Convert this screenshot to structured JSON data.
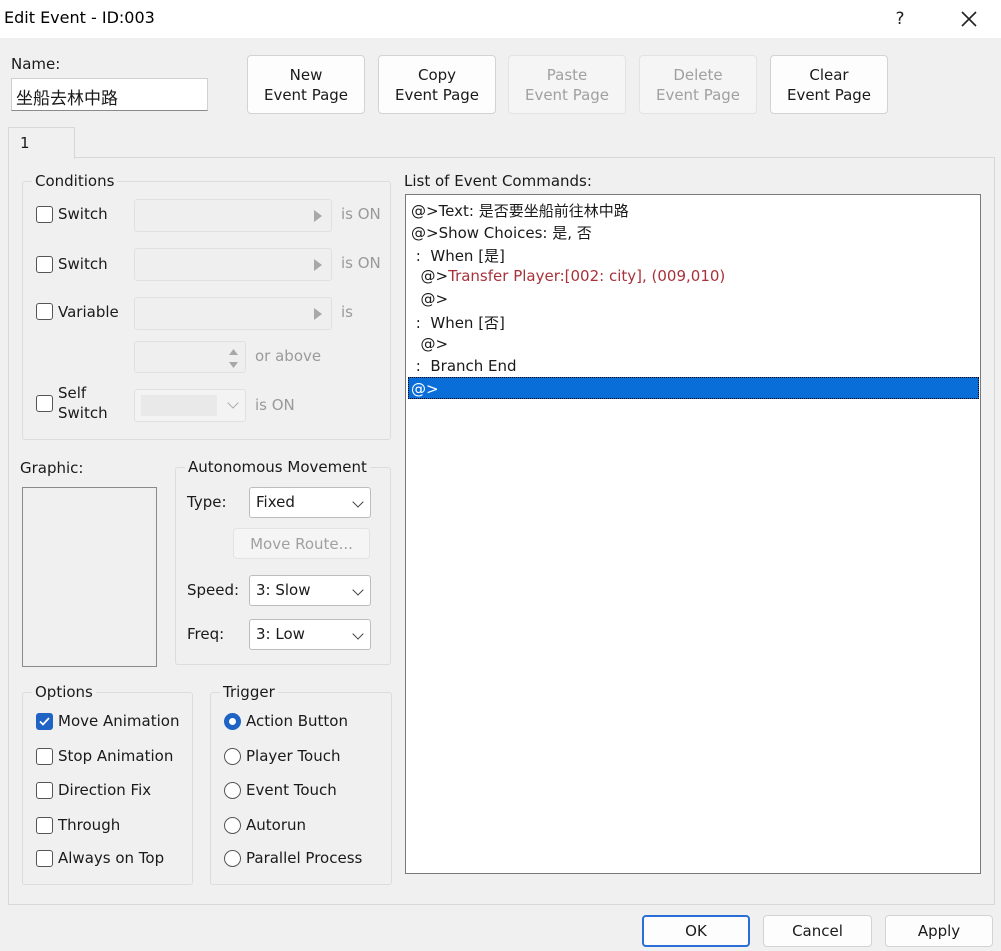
{
  "window": {
    "title": "Edit Event - ID:003",
    "help": "?"
  },
  "name_section": {
    "label": "Name:",
    "value": "坐船去林中路"
  },
  "page_buttons": {
    "new": "New\nEvent Page",
    "copy": "Copy\nEvent Page",
    "paste": "Paste\nEvent Page",
    "delete": "Delete\nEvent Page",
    "clear": "Clear\nEvent Page"
  },
  "tabs": [
    {
      "label": "1"
    }
  ],
  "conditions": {
    "title": "Conditions",
    "switch1": {
      "label": "Switch",
      "suffix": "is ON"
    },
    "switch2": {
      "label": "Switch",
      "suffix": "is ON"
    },
    "variable": {
      "label": "Variable",
      "suffix": "is",
      "above": "or above"
    },
    "self_switch": {
      "label1": "Self",
      "label2": "Switch",
      "suffix": "is ON"
    }
  },
  "graphic": {
    "label": "Graphic:"
  },
  "autonomous": {
    "title": "Autonomous Movement",
    "type_label": "Type:",
    "type_value": "Fixed",
    "move_route": "Move Route...",
    "speed_label": "Speed:",
    "speed_value": "3: Slow",
    "freq_label": "Freq:",
    "freq_value": "3: Low"
  },
  "options": {
    "title": "Options",
    "items": [
      {
        "label": "Move Animation",
        "checked": true
      },
      {
        "label": "Stop Animation",
        "checked": false
      },
      {
        "label": "Direction Fix",
        "checked": false
      },
      {
        "label": "Through",
        "checked": false
      },
      {
        "label": "Always on Top",
        "checked": false
      }
    ]
  },
  "trigger": {
    "title": "Trigger",
    "items": [
      {
        "label": "Action Button",
        "selected": true
      },
      {
        "label": "Player Touch",
        "selected": false
      },
      {
        "label": "Event Touch",
        "selected": false
      },
      {
        "label": "Autorun",
        "selected": false
      },
      {
        "label": "Parallel Process",
        "selected": false
      }
    ]
  },
  "commands": {
    "label": "List of Event Commands:",
    "lines": [
      "@>Text: 是否要坐船前往林中路",
      "@>Show Choices: 是, 否",
      " :  When [是]",
      "  @>",
      "Transfer Player:[002: city], (009,010)",
      "  @>",
      " :  When [否]",
      "  @>",
      " :  Branch End",
      "@>"
    ]
  },
  "footer": {
    "ok": "OK",
    "cancel": "Cancel",
    "apply": "Apply"
  },
  "colors": {
    "accent": "#1f63c4",
    "selection": "#0a6ed8",
    "command_red": "#a8323a"
  }
}
